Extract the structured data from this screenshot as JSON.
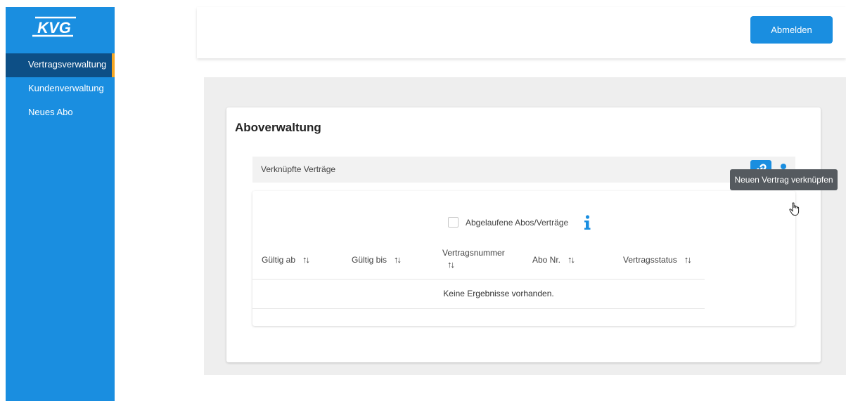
{
  "sidebar": {
    "logo_text": "KVG",
    "items": [
      {
        "label": "Vertragsverwaltung"
      },
      {
        "label": "Kundenverwaltung"
      },
      {
        "label": "Neues Abo"
      }
    ],
    "active_index": 0
  },
  "header": {
    "logout_label": "Abmelden"
  },
  "colors": {
    "primary": "#1a8ee0",
    "sidebar_active": "#0d4f86",
    "active_indicator": "#f5a623",
    "tooltip_bg": "#555a5f"
  },
  "main": {
    "title": "Aboverwaltung",
    "linked_section_label": "Verknüpfte Verträge",
    "link_button_icon": "link-icon",
    "person_button_icon": "person-icon",
    "tooltip": "Neuen Vertrag verknüpfen",
    "filter": {
      "label": "Abgelaufene Abos/Verträge",
      "checked": false,
      "info_icon": "info-icon"
    },
    "table": {
      "columns": [
        {
          "label": "Gültig ab"
        },
        {
          "label": "Gültig bis"
        },
        {
          "label": "Vertragsnummer"
        },
        {
          "label": "Abo Nr."
        },
        {
          "label": "Vertragsstatus"
        }
      ],
      "sort_glyph": "↑↓",
      "empty_message": "Keine Ergebnisse vorhanden."
    }
  }
}
